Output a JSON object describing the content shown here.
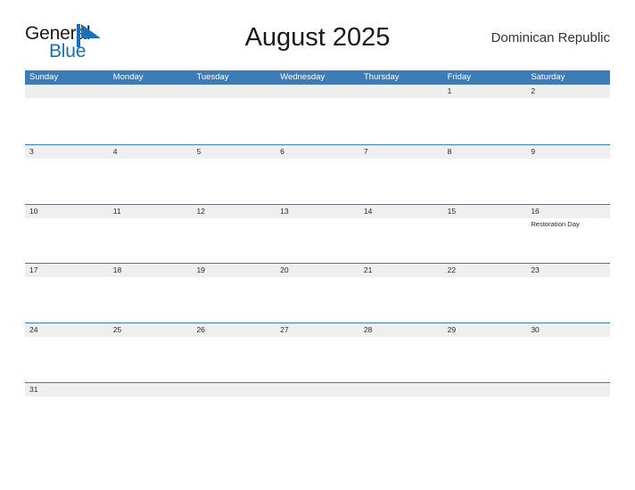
{
  "brand": {
    "name_part1": "General",
    "name_part2": "Blue",
    "mark_icon": "triangle-flag-icon",
    "accent_color": "#1a6fb5"
  },
  "header": {
    "title": "August 2025",
    "region": "Dominican Republic"
  },
  "theme": {
    "header_blue": "#3c7cb8",
    "band_gray": "#efeff0",
    "divider_blue": "#3c7cb8",
    "page_background": "#ffffff",
    "text_dark": "#222222"
  },
  "calendar": {
    "weekdays": [
      "Sunday",
      "Monday",
      "Tuesday",
      "Wednesday",
      "Thursday",
      "Friday",
      "Saturday"
    ],
    "weeks": [
      {
        "days": [
          {
            "date": "",
            "events": []
          },
          {
            "date": "",
            "events": []
          },
          {
            "date": "",
            "events": []
          },
          {
            "date": "",
            "events": []
          },
          {
            "date": "",
            "events": []
          },
          {
            "date": "1",
            "events": []
          },
          {
            "date": "2",
            "events": []
          }
        ]
      },
      {
        "days": [
          {
            "date": "3",
            "events": []
          },
          {
            "date": "4",
            "events": []
          },
          {
            "date": "5",
            "events": []
          },
          {
            "date": "6",
            "events": []
          },
          {
            "date": "7",
            "events": []
          },
          {
            "date": "8",
            "events": []
          },
          {
            "date": "9",
            "events": []
          }
        ]
      },
      {
        "days": [
          {
            "date": "10",
            "events": []
          },
          {
            "date": "11",
            "events": []
          },
          {
            "date": "12",
            "events": []
          },
          {
            "date": "13",
            "events": []
          },
          {
            "date": "14",
            "events": []
          },
          {
            "date": "15",
            "events": []
          },
          {
            "date": "16",
            "events": [
              "Restoration Day"
            ]
          }
        ]
      },
      {
        "days": [
          {
            "date": "17",
            "events": []
          },
          {
            "date": "18",
            "events": []
          },
          {
            "date": "19",
            "events": []
          },
          {
            "date": "20",
            "events": []
          },
          {
            "date": "21",
            "events": []
          },
          {
            "date": "22",
            "events": []
          },
          {
            "date": "23",
            "events": []
          }
        ]
      },
      {
        "days": [
          {
            "date": "24",
            "events": []
          },
          {
            "date": "25",
            "events": []
          },
          {
            "date": "26",
            "events": []
          },
          {
            "date": "27",
            "events": []
          },
          {
            "date": "28",
            "events": []
          },
          {
            "date": "29",
            "events": []
          },
          {
            "date": "30",
            "events": []
          }
        ]
      },
      {
        "days": [
          {
            "date": "31",
            "events": []
          },
          {
            "date": "",
            "events": []
          },
          {
            "date": "",
            "events": []
          },
          {
            "date": "",
            "events": []
          },
          {
            "date": "",
            "events": []
          },
          {
            "date": "",
            "events": []
          },
          {
            "date": "",
            "events": []
          }
        ]
      }
    ]
  }
}
